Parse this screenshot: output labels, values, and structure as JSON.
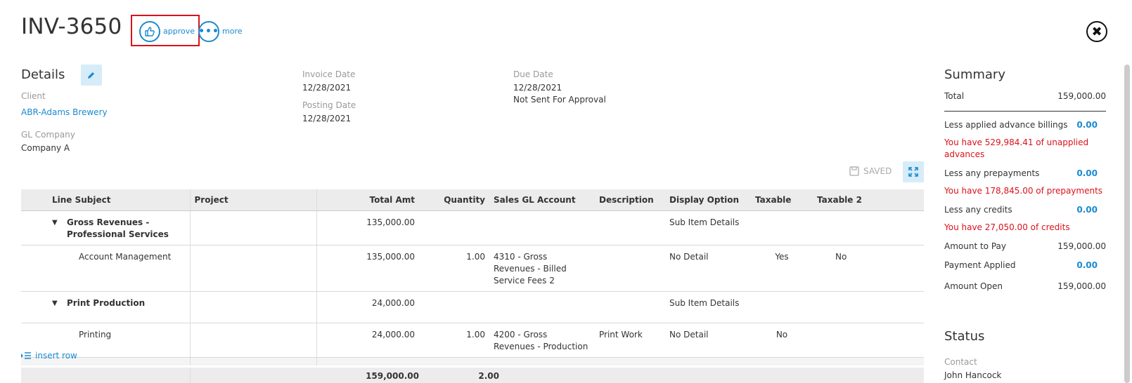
{
  "header": {
    "invoice_number": "INV-3650",
    "approve_label": "approve",
    "more_label": "more",
    "more_glyph": "•••",
    "close_glyph": "✖"
  },
  "details": {
    "title": "Details",
    "client_label": "Client",
    "client_value": "ABR-Adams Brewery",
    "gl_company_label": "GL Company",
    "gl_company_value": "Company A",
    "invoice_date_label": "Invoice Date",
    "invoice_date_value": "12/28/2021",
    "posting_date_label": "Posting Date",
    "posting_date_value": "12/28/2021",
    "due_date_label": "Due Date",
    "due_date_value": "12/28/2021",
    "approval_status": "Not Sent For Approval"
  },
  "toolbar": {
    "saved_label": "SAVED"
  },
  "table": {
    "columns": [
      "Line Subject",
      "Project",
      "Total Amt",
      "Quantity",
      "Sales GL Account",
      "Description",
      "Display Option",
      "Taxable",
      "Taxable 2"
    ],
    "rows": [
      {
        "subject": "Gross Revenues - Professional Services",
        "project": "",
        "total": "135,000.00",
        "quantity": "",
        "gl_account": "",
        "description": "",
        "display": "Sub Item Details",
        "taxable": "",
        "taxable2": ""
      },
      {
        "subject": "Account Management",
        "project": "",
        "total": "135,000.00",
        "quantity": "1.00",
        "gl_account": "4310 - Gross Revenues - Billed Service Fees 2",
        "description": "",
        "display": "No Detail",
        "taxable": "Yes",
        "taxable2": "No"
      },
      {
        "subject": "Print Production",
        "project": "",
        "total": "24,000.00",
        "quantity": "",
        "gl_account": "",
        "description": "",
        "display": "Sub Item Details",
        "taxable": "",
        "taxable2": ""
      },
      {
        "subject": "Printing",
        "project": "",
        "total": "24,000.00",
        "quantity": "1.00",
        "gl_account": "4200 - Gross Revenues - Production",
        "description": "Print Work",
        "display": "No Detail",
        "taxable": "No",
        "taxable2": ""
      }
    ],
    "insert_row_label": "insert row",
    "total_amt": "159,000.00",
    "total_qty": "2.00"
  },
  "summary": {
    "title": "Summary",
    "total_label": "Total",
    "total_value": "159,000.00",
    "advance_label": "Less applied advance billings",
    "advance_value": "0.00",
    "advance_warning": "You have 529,984.41 of unapplied advances",
    "prepay_label": "Less any prepayments",
    "prepay_value": "0.00",
    "prepay_warning": "You have 178,845.00 of prepayments",
    "credits_label": "Less any credits",
    "credits_value": "0.00",
    "credits_warning": "You have 27,050.00 of credits",
    "amount_to_pay_label": "Amount to Pay",
    "amount_to_pay_value": "159,000.00",
    "payment_applied_label": "Payment Applied",
    "payment_applied_value": "0.00",
    "amount_open_label": "Amount Open",
    "amount_open_value": "159,000.00"
  },
  "status": {
    "title": "Status",
    "contact_label": "Contact",
    "contact_value": "John Hancock"
  },
  "colors": {
    "accent": "#1a8ad1",
    "warning": "#d9121b",
    "highlight_box": "#d9121b"
  }
}
